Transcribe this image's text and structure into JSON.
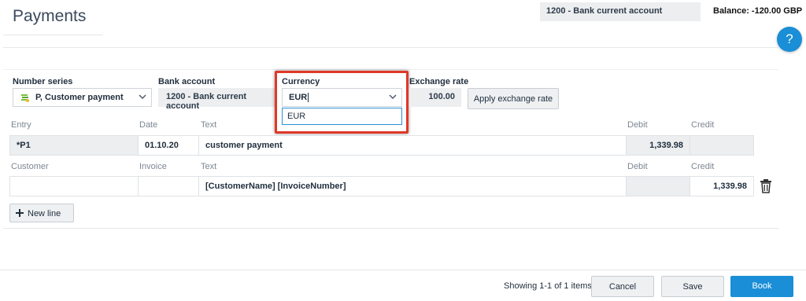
{
  "header": {
    "title": "Payments",
    "account": "1200 - Bank current account",
    "balance": "Balance: -120.00 GBP",
    "help_label": "?"
  },
  "form": {
    "number_series": {
      "label": "Number series",
      "value": "P, Customer payment"
    },
    "bank_account": {
      "label": "Bank account",
      "value": "1200 - Bank current account"
    },
    "currency": {
      "label": "Currency",
      "value": "EUR",
      "options": [
        "EUR"
      ]
    },
    "exchange_rate": {
      "label": "Exchange rate",
      "value": "100.00"
    },
    "apply_button": "Apply exchange rate"
  },
  "entry_table": {
    "headers": [
      "Entry",
      "Date",
      "Text",
      "Debit",
      "Credit"
    ],
    "row": {
      "entry": "*P1",
      "date": "01.10.20",
      "text": "customer payment",
      "debit": "1,339.98",
      "credit": ""
    }
  },
  "line_table": {
    "headers": [
      "Customer",
      "Invoice",
      "Text",
      "Debit",
      "Credit"
    ],
    "row": {
      "customer": "",
      "invoice": "",
      "text": "[CustomerName] [InvoiceNumber]",
      "debit": "",
      "credit": "1,339.98"
    }
  },
  "new_line_button": "New line",
  "footer": {
    "showing": "Showing 1-1 of 1 items",
    "cancel": "Cancel",
    "save": "Save",
    "book": "Book"
  },
  "colors": {
    "primary": "#1a8ed6",
    "highlight": "#e03828",
    "readonly_bg": "#eceeef"
  },
  "icons": [
    "customer-payment-icon",
    "chevron-down-icon",
    "trash-icon",
    "plus-icon",
    "help-icon"
  ]
}
